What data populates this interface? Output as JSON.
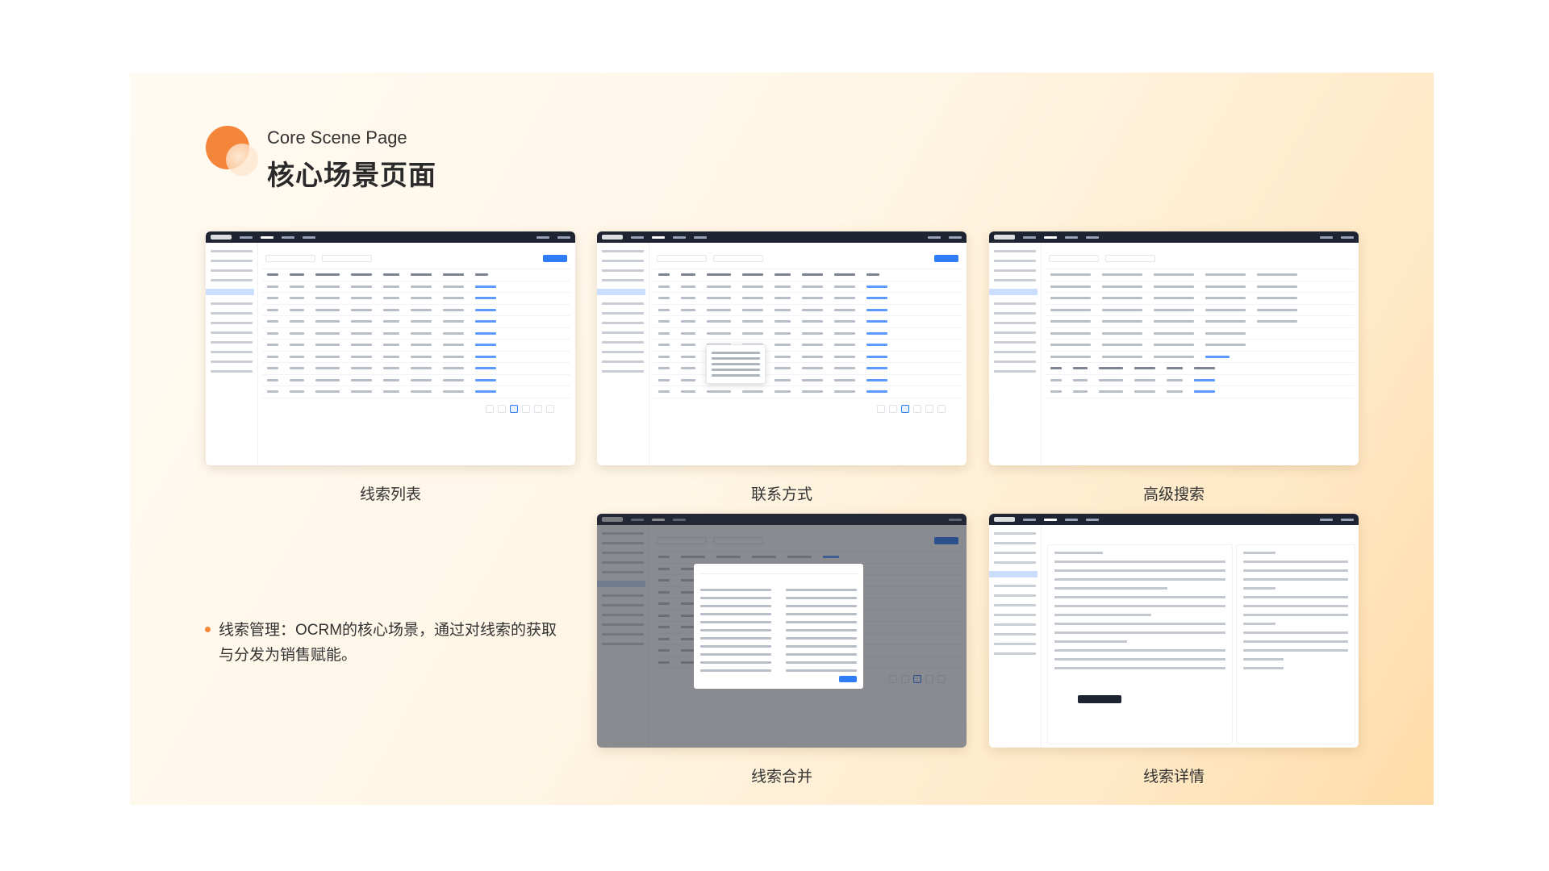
{
  "header": {
    "title_en": "Core Scene Page",
    "title_zh": "核心场景页面"
  },
  "screens": [
    {
      "caption": "线索列表"
    },
    {
      "caption": "联系方式"
    },
    {
      "caption": "高级搜索"
    },
    {
      "caption": "线索合并"
    },
    {
      "caption": "线索详情"
    }
  ],
  "description": {
    "text": "线索管理：OCRM的核心场景，通过对线索的获取与分发为销售赋能。"
  },
  "colors": {
    "accent": "#f4863a",
    "ui_dark": "#1f2433",
    "ui_blue": "#2f7df6"
  }
}
